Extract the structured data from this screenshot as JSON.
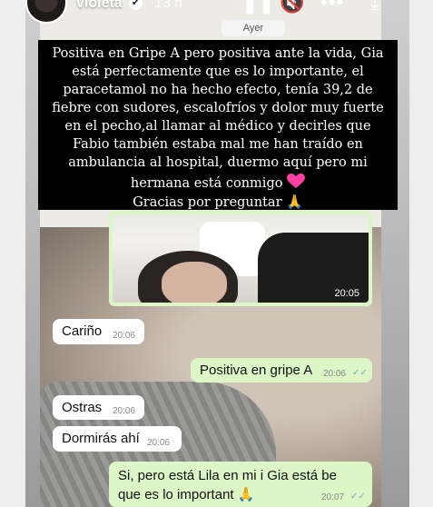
{
  "story": {
    "username": "violeta",
    "time": "13 h",
    "verified_icon": "verified-check-icon",
    "icons": [
      "pause-icon",
      "mute-icon",
      "more-icon",
      "share-icon"
    ]
  },
  "chat": {
    "date_label": "Ayer",
    "image_message": {
      "time": "20:05",
      "ticks": "✓✓"
    },
    "messages": [
      {
        "dir": "in",
        "text": "Cariño",
        "time": "20:06"
      },
      {
        "dir": "out",
        "text": "Positiva en gripe A",
        "time": "20:06",
        "ticks": "✓✓"
      },
      {
        "dir": "in",
        "text": "Ostras",
        "time": "20:06"
      },
      {
        "dir": "in",
        "text": "Dormirás ahí",
        "time": "20:06"
      },
      {
        "dir": "out",
        "text": "Si, pero está Lila en mi i Gia está be que es lo importan",
        "suffix": "t 🙏",
        "time": "20:07",
        "ticks": "✓✓"
      }
    ]
  },
  "overlay": {
    "text": "Positiva en Gripe A pero positiva ante la vida, Gia está perfectamente que es lo importante, el paracetamol no ha hecho efecto, tenía 39,2 de fiebre con sudores, escalofríos y dolor muy fuerte en el pecho,al llamar al médico y decirles que Fabio también estaba mal me han traído en ambulancia al hospital, duermo aquí pero mi hermana está conmigo",
    "thanks": "Gracias por preguntar",
    "pray_emoji": "🙏"
  },
  "colors": {
    "overlay_bg": "#000000",
    "outgoing_bubble": "#dcf6c6",
    "incoming_bubble": "#ffffff",
    "heart": "#ff3fa4"
  }
}
